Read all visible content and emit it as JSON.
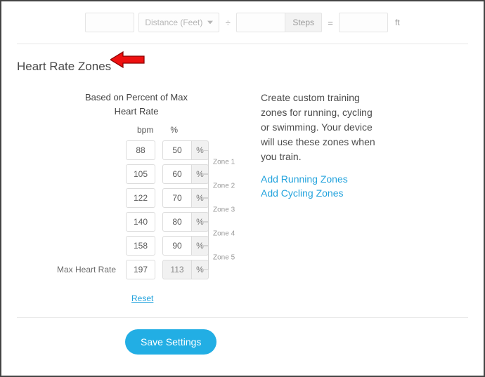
{
  "formula": {
    "select_placeholder": "Distance (Feet)",
    "op_divide": "÷",
    "unit_steps": "Steps",
    "op_equals": "=",
    "unit_result": "ft"
  },
  "section": {
    "title": "Heart Rate Zones"
  },
  "zones": {
    "based_on_line1": "Based on Percent of Max",
    "based_on_line2": "Heart Rate",
    "col_bpm": "bpm",
    "col_pct": "%",
    "pct_symbol": "%",
    "bracket_labels": [
      "Zone 1",
      "Zone 2",
      "Zone 3",
      "Zone 4",
      "Zone 5"
    ],
    "rows": [
      {
        "label": "",
        "bpm": "88",
        "pct": "50"
      },
      {
        "label": "",
        "bpm": "105",
        "pct": "60"
      },
      {
        "label": "",
        "bpm": "122",
        "pct": "70"
      },
      {
        "label": "",
        "bpm": "140",
        "pct": "80"
      },
      {
        "label": "",
        "bpm": "158",
        "pct": "90"
      },
      {
        "label": "Max Heart Rate",
        "bpm": "197",
        "pct": "113"
      }
    ],
    "reset": "Reset"
  },
  "info": {
    "text": "Create custom training zones for running, cycling or swimming. Your device will use these zones when you train.",
    "link_running": "Add Running Zones",
    "link_cycling": "Add Cycling Zones"
  },
  "footer": {
    "save": "Save Settings"
  },
  "colors": {
    "accent": "#22aee4",
    "link": "#23a3dd"
  }
}
